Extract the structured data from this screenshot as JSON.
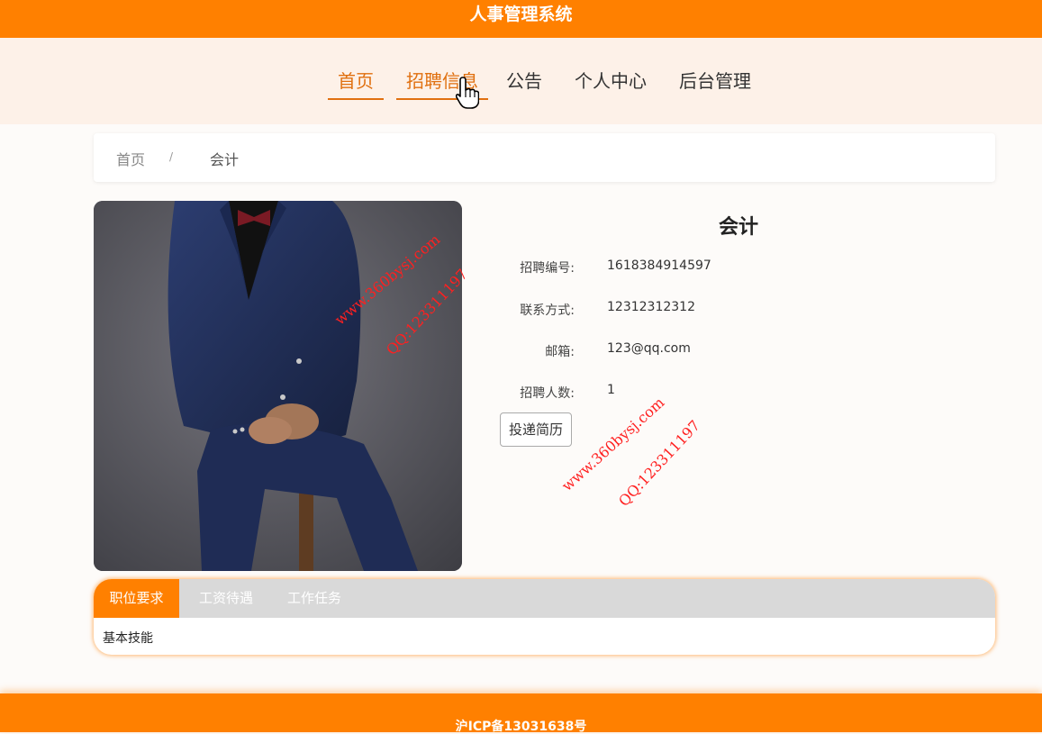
{
  "header": {
    "title": "人事管理系统"
  },
  "nav": {
    "items": [
      {
        "label": "首页"
      },
      {
        "label": "招聘信息"
      },
      {
        "label": "公告"
      },
      {
        "label": "个人中心"
      },
      {
        "label": "后台管理"
      }
    ],
    "active": "首页"
  },
  "breadcrumb": {
    "home": "首页",
    "separator": "/",
    "current": "会计"
  },
  "job": {
    "title": "会计",
    "fields": [
      {
        "label": "招聘编号:",
        "value": "1618384914597"
      },
      {
        "label": "联系方式:",
        "value": "12312312312"
      },
      {
        "label": "邮箱:",
        "value": "123@qq.com"
      },
      {
        "label": "招聘人数:",
        "value": "1"
      }
    ],
    "apply_label": "投递简历"
  },
  "watermarks": [
    {
      "site": "www.360bysj.com",
      "qq": "QQ:123311197"
    },
    {
      "site": "www.360bysj.com",
      "qq": "QQ:123311197"
    }
  ],
  "tabs": {
    "items": [
      {
        "label": "职位要求"
      },
      {
        "label": "工资待遇"
      },
      {
        "label": "工作任务"
      }
    ],
    "active_content": "基本技能"
  },
  "footer": {
    "text": "沪ICP备13031638号"
  },
  "colors": {
    "accent": "#ff8000",
    "nav_bg": "#fdf1e8",
    "watermark": "#ff2020"
  }
}
